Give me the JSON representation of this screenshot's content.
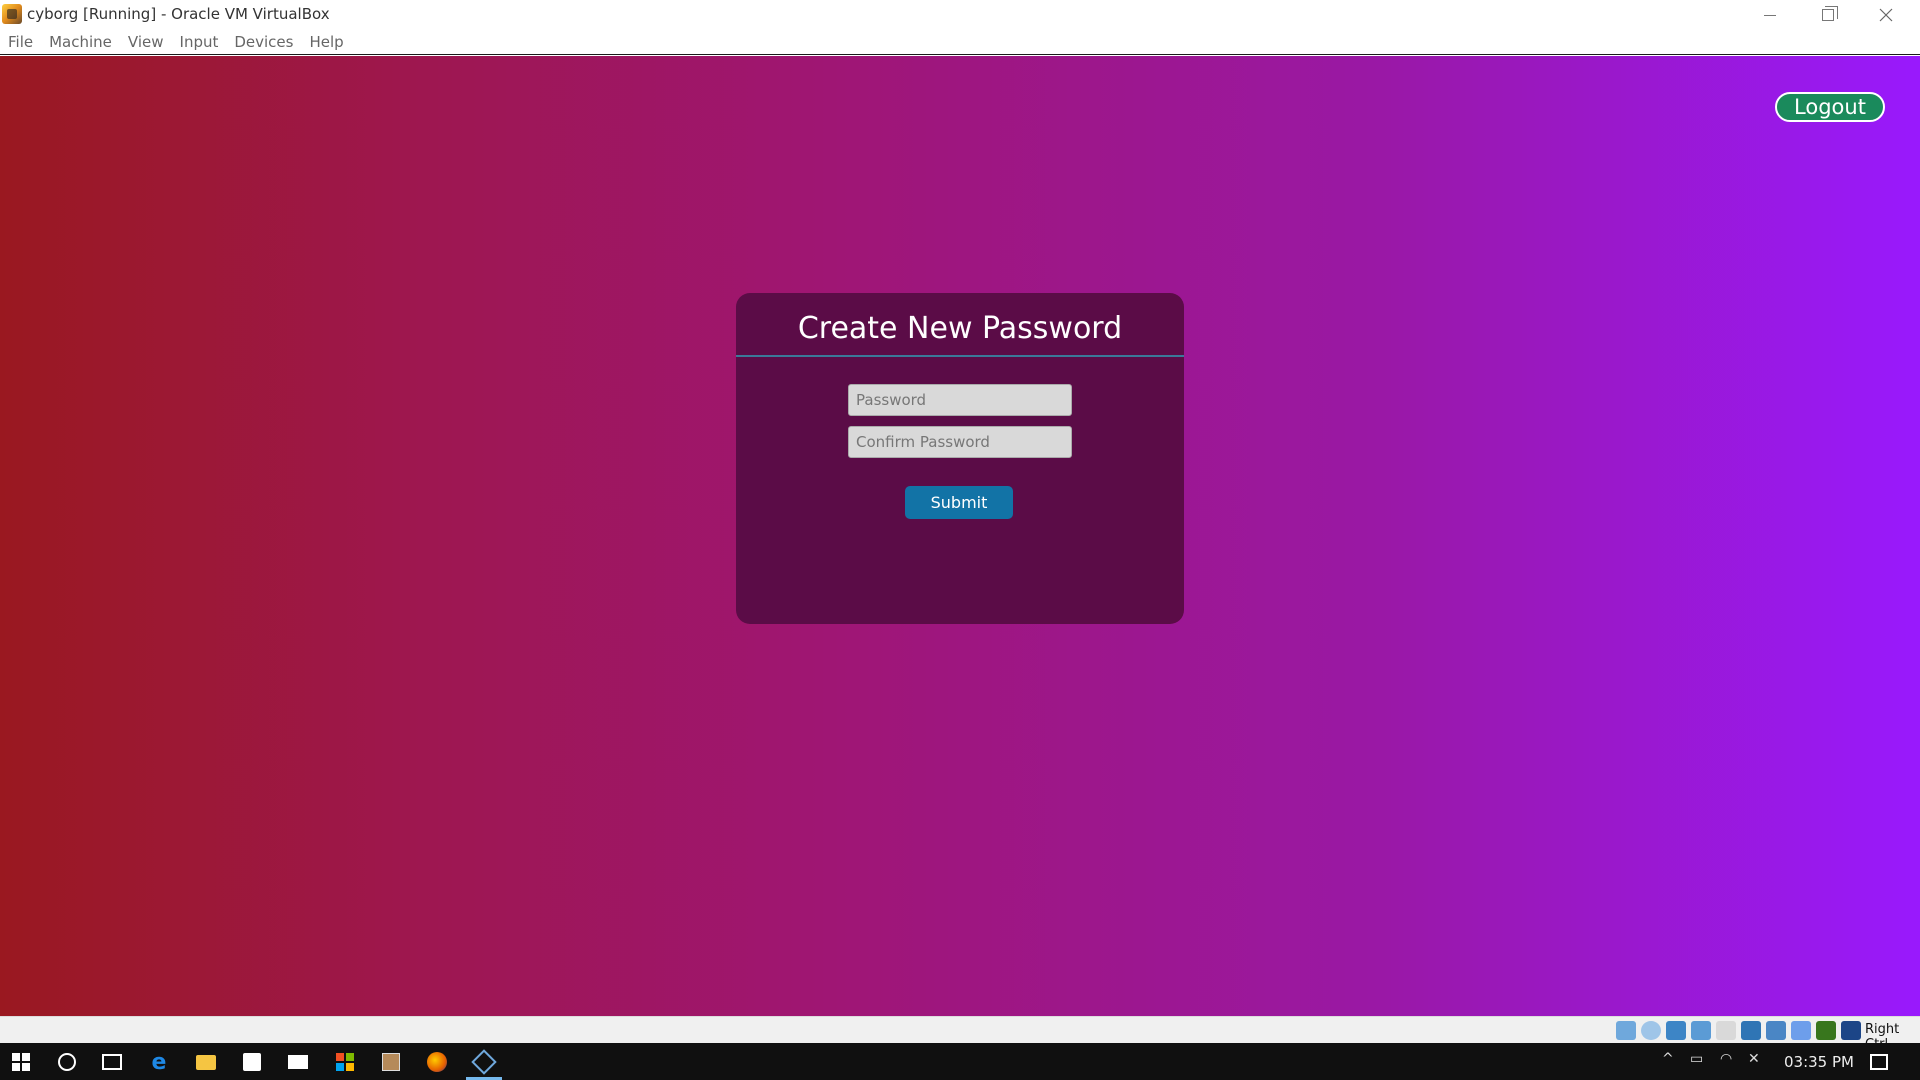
{
  "window": {
    "title": "cyborg [Running] - Oracle VM VirtualBox",
    "menu": [
      "File",
      "Machine",
      "View",
      "Input",
      "Devices",
      "Help"
    ]
  },
  "page": {
    "logout_label": "Logout",
    "form": {
      "title": "Create New Password",
      "password_placeholder": "Password",
      "confirm_placeholder": "Confirm Password",
      "submit_label": "Submit"
    }
  },
  "status_bar": {
    "host_key": "Right Ctrl",
    "icons": [
      "hard-disk-icon",
      "optical-drive-icon",
      "audio-icon",
      "network-icon",
      "usb-icon",
      "shared-folders-icon",
      "display-icon",
      "recording-icon",
      "cpu-icon",
      "mouse-integration-icon",
      "keyboard-icon"
    ]
  },
  "taskbar": {
    "time": "03:35 PM",
    "apps": [
      "start-icon",
      "cortana-icon",
      "task-view-icon",
      "edge-icon",
      "file-explorer-icon",
      "store-icon",
      "mail-icon",
      "windows-app-icon",
      "archive-icon",
      "firefox-icon",
      "virtualbox-icon"
    ]
  },
  "colors": {
    "gradient_left": "#9a1820",
    "gradient_right": "#9919fd",
    "card_bg": "#5b0c47",
    "submit_bg": "#1273a6",
    "logout_bg": "#1a8a5c"
  }
}
